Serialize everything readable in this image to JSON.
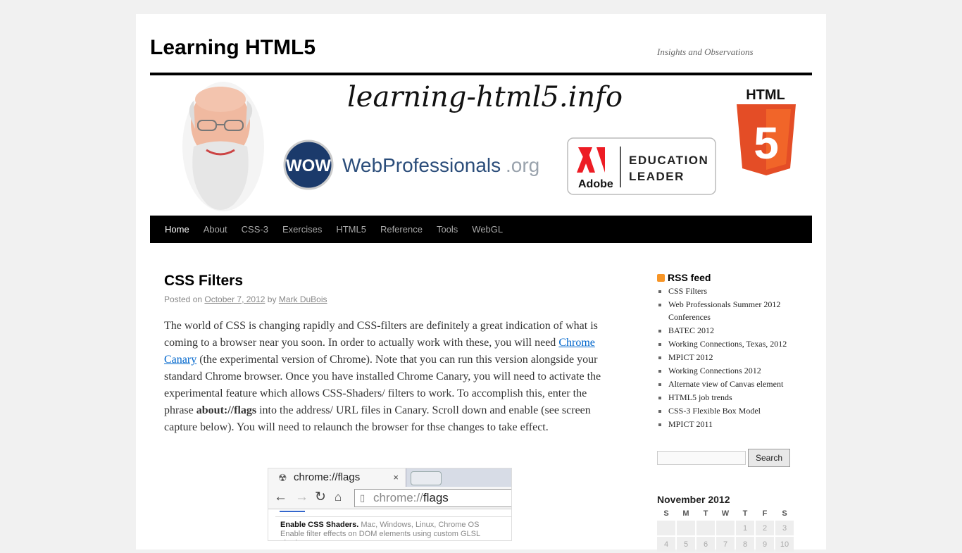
{
  "site": {
    "title": "Learning HTML5",
    "description": "Insights and Observations"
  },
  "banner": {
    "domain": "learning-html5.info",
    "wow_badge": "WOW",
    "webpros_main": "WebProfessionals",
    "webpros_suffix": ".org",
    "adobe_word": "Adobe",
    "edu_line1": "EDUCATION",
    "edu_line2": "LEADER",
    "html_label": "HTML",
    "html_digit": "5"
  },
  "nav": {
    "items": [
      "Home",
      "About",
      "CSS-3",
      "Exercises",
      "HTML5",
      "Reference",
      "Tools",
      "WebGL"
    ],
    "current": "Home"
  },
  "post": {
    "title": "CSS Filters",
    "posted_on_label": "Posted on",
    "date": "October 7, 2012",
    "by_label": "by",
    "author": "Mark DuBois",
    "body_part1": "The world of CSS is changing rapidly and CSS-filters are definitely a great indication of what is coming to a browser near you soon. In order to actually work with these, you will need ",
    "link_text": "Chrome Canary",
    "body_part2": " (the experimental version of Chrome). Note that you can run this version alongside your standard Chrome browser. Once you have installed Chrome Canary, you will need to activate the experimental feature which allows CSS-Shaders/ filters to work. To accomplish this, enter the phrase ",
    "bold_text": "about://flags",
    "body_part3": " into the address/ URL files in Canary. Scroll down and enable (see screen capture below). You will need to relaunch the browser for thse changes to take effect."
  },
  "screenshot": {
    "tab_title": "chrome://flags",
    "tab_close": "×",
    "url_scheme": "chrome://",
    "url_path": "flags",
    "flag_name": "Enable CSS Shaders.",
    "flag_platforms": "Mac, Windows, Linux, Chrome OS",
    "flag_desc": "Enable filter effects on DOM elements using custom GLSL shaders."
  },
  "sidebar": {
    "rss_title": "RSS feed",
    "rss_items": [
      "CSS Filters",
      "Web Professionals Summer 2012 Conferences",
      "BATEC 2012",
      "Working Connections, Texas, 2012",
      "MPICT 2012",
      "Working Connections 2012",
      "Alternate view of Canvas element",
      "HTML5 job trends",
      "CSS-3 Flexible Box Model",
      "MPICT 2011"
    ],
    "search_value": "",
    "search_button": "Search"
  },
  "calendar": {
    "caption": "November 2012",
    "days": [
      "S",
      "M",
      "T",
      "W",
      "T",
      "F",
      "S"
    ],
    "rows": [
      [
        "",
        "",
        "",
        "",
        "1",
        "2",
        "3"
      ],
      [
        "4",
        "5",
        "6",
        "7",
        "8",
        "9",
        "10"
      ]
    ]
  },
  "colors": {
    "nav_bg": "#000000",
    "link": "#0066cc",
    "html5_orange": "#e44d26",
    "wow_navy": "#1b3a6b",
    "adobe_red": "#ed1c24",
    "rss_orange": "#f79526"
  }
}
